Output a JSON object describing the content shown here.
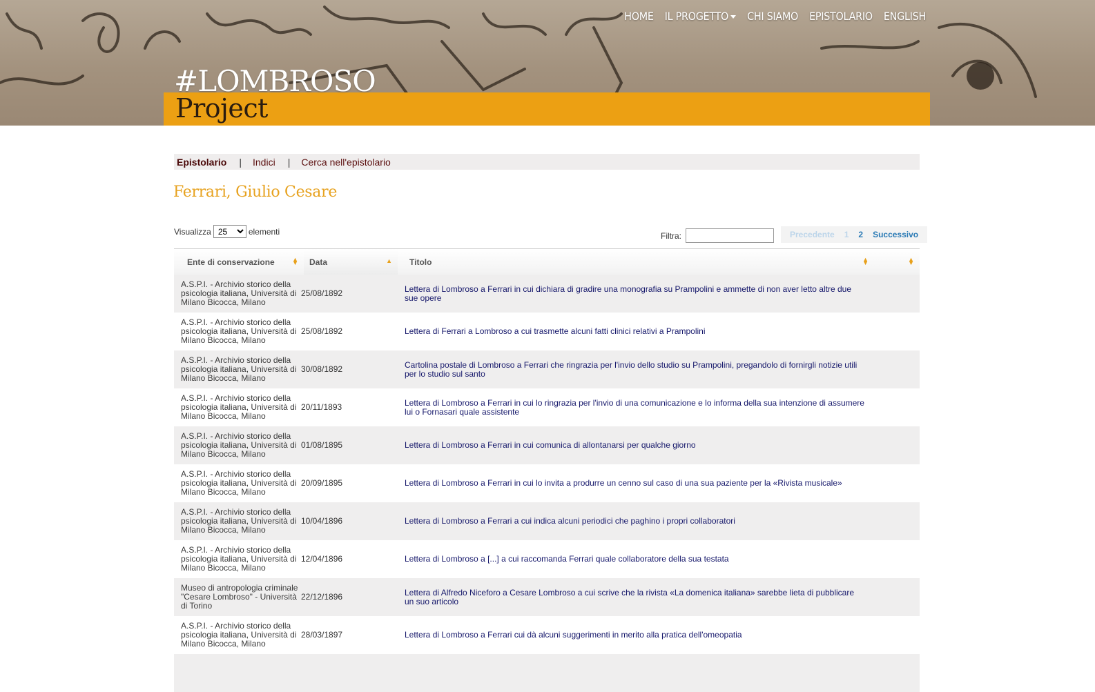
{
  "header": {
    "nav": [
      {
        "label": "HOME",
        "has_caret": false
      },
      {
        "label": "IL PROGETTO",
        "has_caret": true
      },
      {
        "label": "CHI SIAMO",
        "has_caret": false
      },
      {
        "label": "EPISTOLARIO",
        "has_caret": false
      },
      {
        "label": "ENGLISH",
        "has_caret": false
      }
    ],
    "logo_line1": "#LOMBROSO",
    "logo_line2": "Project"
  },
  "subnav": {
    "active": "Epistolario",
    "indici": "Indici",
    "cerca": "Cerca nell'epistolario",
    "separator": "|"
  },
  "page_title": "Ferrari, Giulio Cesare",
  "length": {
    "prefix": "Visualizza",
    "value": "25",
    "suffix": "elementi"
  },
  "filter": {
    "label": "Filtra:",
    "value": ""
  },
  "pager": {
    "prev": "Precedente",
    "page1": "1",
    "page2": "2",
    "next": "Successivo"
  },
  "table": {
    "headers": {
      "ente": "Ente di conservazione",
      "data": "Data",
      "titolo": "Titolo"
    },
    "rows": [
      {
        "ente": "A.S.P.I. - Archivio storico della psicologia italiana, Università di Milano Bicocca, Milano",
        "data": "25/08/1892",
        "titolo": "Lettera di Lombroso a Ferrari in cui dichiara di gradire una monografia su Prampolini e ammette di non aver letto altre due sue opere"
      },
      {
        "ente": "A.S.P.I. - Archivio storico della psicologia italiana, Università di Milano Bicocca, Milano",
        "data": "25/08/1892",
        "titolo": "Lettera di Ferrari a Lombroso a cui trasmette alcuni fatti clinici relativi a Prampolini"
      },
      {
        "ente": "A.S.P.I. - Archivio storico della psicologia italiana, Università di Milano Bicocca, Milano",
        "data": "30/08/1892",
        "titolo": "Cartolina postale di Lombroso a Ferrari che ringrazia per l'invio dello studio su Prampolini, pregandolo di fornirgli notizie utili per lo studio sul santo"
      },
      {
        "ente": "A.S.P.I. - Archivio storico della psicologia italiana, Università di Milano Bicocca, Milano",
        "data": "20/11/1893",
        "titolo": "Lettera di Lombroso a Ferrari in cui lo ringrazia per l'invio di una comunicazione e lo informa della sua intenzione di assumere lui o Fornasari quale assistente"
      },
      {
        "ente": "A.S.P.I. - Archivio storico della psicologia italiana, Università di Milano Bicocca, Milano",
        "data": "01/08/1895",
        "titolo": "Lettera di Lombroso a Ferrari in cui comunica di allontanarsi per qualche giorno"
      },
      {
        "ente": "A.S.P.I. - Archivio storico della psicologia italiana, Università di Milano Bicocca, Milano",
        "data": "20/09/1895",
        "titolo": "Lettera di Lombroso a Ferrari in cui lo invita a produrre un cenno sul caso di una sua paziente per la «Rivista musicale»"
      },
      {
        "ente": "A.S.P.I. - Archivio storico della psicologia italiana, Università di Milano Bicocca, Milano",
        "data": "10/04/1896",
        "titolo": "Lettera di Lombroso a Ferrari a cui indica alcuni periodici che paghino i propri collaboratori"
      },
      {
        "ente": "A.S.P.I. - Archivio storico della psicologia italiana, Università di Milano Bicocca, Milano",
        "data": "12/04/1896",
        "titolo": "Lettera di Lombroso a [...] a cui raccomanda Ferrari quale collaboratore della sua testata"
      },
      {
        "ente": "Museo di antropologia criminale \"Cesare Lombroso\" - Università di Torino",
        "data": "22/12/1896",
        "titolo": "Lettera di Alfredo Niceforo a Cesare Lombroso a cui scrive che la rivista «La domenica italiana» sarebbe lieta di pubblicare un suo articolo"
      },
      {
        "ente": "A.S.P.I. - Archivio storico della psicologia italiana, Università di Milano Bicocca, Milano",
        "data": "28/03/1897",
        "titolo": "Lettera di Lombroso a Ferrari cui dà alcuni suggerimenti in merito alla pratica dell'omeopatia"
      },
      {
        "ente": "",
        "data": "",
        "titolo": ""
      }
    ]
  },
  "colors": {
    "accent": "#eca013",
    "title": "#e7a21f",
    "link": "#16186b",
    "subnav_text": "#5b0f0f",
    "pager_active": "#2a7ab5"
  }
}
